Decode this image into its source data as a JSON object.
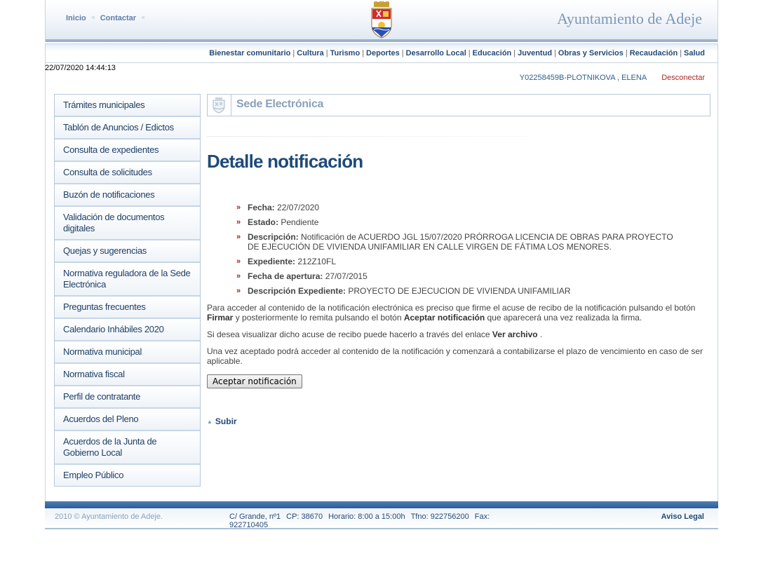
{
  "header": {
    "top_links": [
      "Inicio",
      "Contactar"
    ],
    "brand": "Ayuntamiento de Adeje"
  },
  "nav": {
    "items": [
      "Bienestar comunitario",
      "Cultura",
      "Turismo",
      "Deportes",
      "Desarrollo Local",
      "Educación",
      "Juventud",
      "Obras y Servicios",
      "Recaudación",
      "Salud"
    ]
  },
  "timestamp": "22/07/2020 14:44:13",
  "user": {
    "name": "Y02258459B-PLOTNIKOVA , ELENA",
    "logout_label": "Desconectar"
  },
  "sidebar": {
    "items": [
      "Trámites municipales",
      "Tablón de Anuncios / Edictos",
      "Consulta de expedientes",
      "Consulta de solicitudes",
      "Buzón de notificaciones",
      "Validación de documentos digitales",
      "Quejas y sugerencias",
      "Normativa reguladora de la Sede Electrónica",
      "Preguntas frecuentes",
      "Calendario Inhábiles 2020",
      "Normativa municipal",
      "Normativa fiscal",
      "Perfil de contratante",
      "Acuerdos del Pleno",
      "Acuerdos de la Junta de Gobierno Local",
      "Empleo Público"
    ]
  },
  "sede": {
    "title": "Sede Electrónica"
  },
  "main": {
    "title": "Detalle notificación",
    "details": [
      {
        "label": "Fecha:",
        "value": "22/07/2020"
      },
      {
        "label": "Estado:",
        "value": "Pendiente"
      },
      {
        "label": "Descripción:",
        "value": "Notificación de ACUERDO JGL 15/07/2020 PRÓRROGA LICENCIA DE OBRAS PARA PROYECTO DE EJECUCIÓN DE VIVIENDA UNIFAMILIAR EN CALLE VIRGEN DE FÁTIMA LOS MENORES."
      },
      {
        "label": "Expediente:",
        "value": "212Z10FL"
      },
      {
        "label": "Fecha de apertura:",
        "value": "27/07/2015"
      },
      {
        "label": "Descripción Expediente:",
        "value": "PROYECTO DE EJECUCION DE VIVIENDA UNIFAMILIAR"
      }
    ],
    "para1": {
      "a": "Para acceder al contenido de la notificación electrónica es preciso que firme el acuse de recibo de la notificación pulsando el botón ",
      "b": "Firmar",
      "c": " y posteriormente lo remita pulsando el botón ",
      "d": "Aceptar notificación",
      "e": " que aparecerá una vez realizada la firma."
    },
    "para2": {
      "a": "Si desea visualizar dicho acuse de recibo puede hacerlo a través del enlace ",
      "b": "Ver archivo",
      "c": " ."
    },
    "para3": "Una vez aceptado podrá acceder al contenido de la notificación y comenzará a contabilizarse el plazo de vencimiento en caso de ser aplicable.",
    "accept_button": "Aceptar notificación",
    "subir": "Subir"
  },
  "footer": {
    "copyright": "2010 © Ayuntamiento de Adeje.",
    "address": "C/ Grande, nº1",
    "cp": "CP: 38670",
    "horario": "Horario: 8:00 a 15:00h",
    "tfno": "Tfno: 922756200",
    "fax": "Fax: 922710405",
    "legal": "Aviso Legal"
  }
}
